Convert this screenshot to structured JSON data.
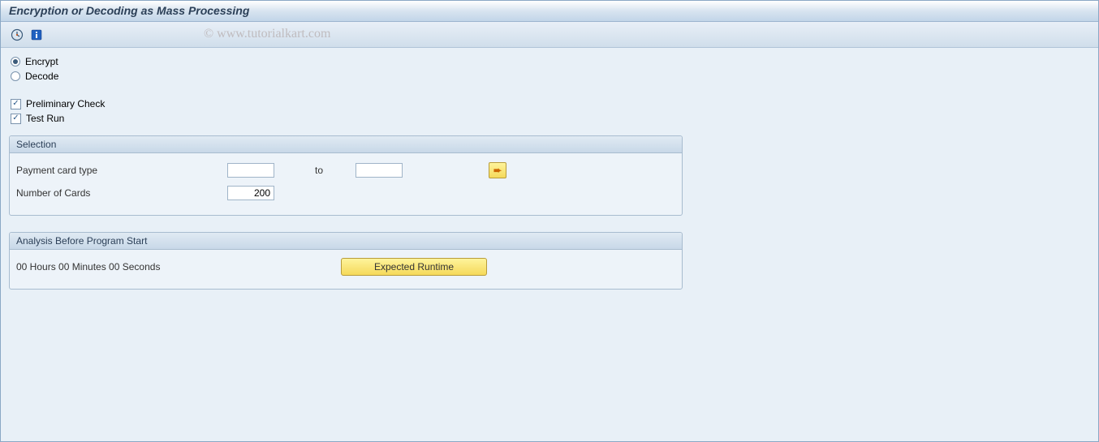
{
  "title": "Encryption or Decoding as Mass Processing",
  "watermark": "© www.tutorialkart.com",
  "radios": {
    "encrypt": "Encrypt",
    "decode": "Decode"
  },
  "checkboxes": {
    "preliminary": "Preliminary Check",
    "test_run": "Test Run"
  },
  "selection": {
    "header": "Selection",
    "card_type_label": "Payment card type",
    "to_label": "to",
    "card_type_from": "",
    "card_type_to": "",
    "num_cards_label": "Number of Cards",
    "num_cards_value": "200"
  },
  "analysis": {
    "header": "Analysis Before Program Start",
    "runtime_text": "00 Hours 00 Minutes 00 Seconds",
    "button_label": "Expected Runtime"
  }
}
